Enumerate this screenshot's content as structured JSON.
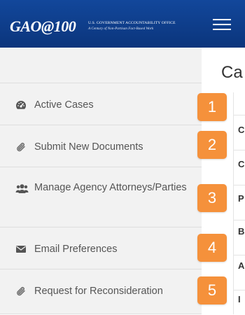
{
  "header": {
    "logo_text": "GAO@100",
    "logo_line1": "U.S. GOVERNMENT ACCOUNTABILITY OFFICE",
    "logo_line2": "A Century of Non-Partisan Fact-Based Work"
  },
  "sidebar": {
    "items": [
      {
        "label": "Active Cases",
        "icon": "tachometer-icon",
        "badge": "1"
      },
      {
        "label": "Submit New Documents",
        "icon": "paperclip-icon",
        "badge": "2"
      },
      {
        "label": "Manage Agency Attorneys/Parties",
        "icon": "users-icon",
        "badge": "3"
      },
      {
        "label": "Email Preferences",
        "icon": "envelope-icon",
        "badge": "4"
      },
      {
        "label": "Request for Reconsideration",
        "icon": "paperclip-icon",
        "badge": "5"
      }
    ]
  },
  "main": {
    "title": "Ca",
    "rows": [
      "C",
      "C",
      "P",
      "B",
      "A",
      "I"
    ]
  },
  "colors": {
    "header_bg": "#0d3c8a",
    "badge": "#f5913b",
    "sidebar_bg": "#f2f2f2"
  }
}
